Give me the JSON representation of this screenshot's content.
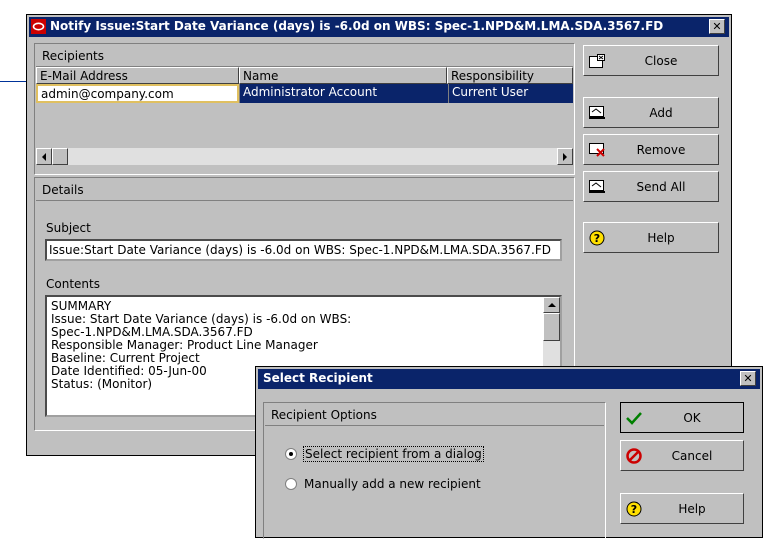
{
  "main_window": {
    "title": "Notify Issue:Start Date Variance (days) is -6.0d on WBS: Spec-1.NPD&M.LMA.SDA.3567.FD",
    "recipients_label": "Recipients",
    "columns": [
      "E-Mail Address",
      "Name",
      "Responsibility"
    ],
    "row": {
      "email": "admin@company.com",
      "name": "Administrator Account",
      "responsibility": "Current User"
    },
    "details_label": "Details",
    "subject_label": "Subject",
    "subject_value": "Issue:Start Date Variance (days) is -6.0d on WBS: Spec-1.NPD&M.LMA.SDA.3567.FD",
    "contents_label": "Contents",
    "contents_lines": [
      "SUMMARY",
      "Issue:  Start Date Variance (days) is -6.0d on WBS:",
      "Spec-1.NPD&M.LMA.SDA.3567.FD",
      "Responsible Manager:  Product Line Manager",
      "Baseline:  Current Project",
      "Date Identified:  05-Jun-00",
      "Status:  (Monitor)"
    ],
    "buttons": {
      "close": "Close",
      "add": "Add",
      "remove": "Remove",
      "send_all": "Send All",
      "help": "Help"
    }
  },
  "select_recipient_dialog": {
    "title": "Select Recipient",
    "options_label": "Recipient Options",
    "option_dialog": "Select recipient from a dialog",
    "option_manual": "Manually add a new recipient",
    "selected_option": "dialog",
    "buttons": {
      "ok": "OK",
      "cancel": "Cancel",
      "help": "Help"
    }
  },
  "colors": {
    "title_bar": "#0a246a",
    "selection": "#0a246a",
    "window_face": "#c0c0c0",
    "callout_line": "#003399"
  }
}
